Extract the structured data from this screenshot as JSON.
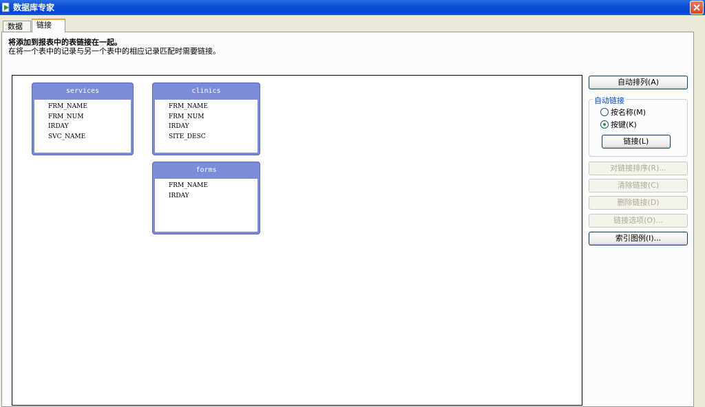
{
  "window": {
    "title": "数据库专家"
  },
  "tabs": [
    {
      "label": "数据"
    },
    {
      "label": "链接"
    }
  ],
  "header": {
    "title": "将添加到报表中的表链接在一起。",
    "subtitle": "在将一个表中的记录与另一个表中的相应记录匹配时需要链接。"
  },
  "tables": [
    {
      "name": "services",
      "fields": [
        "FRM_NAME",
        "FRM_NUM",
        "IRDAY",
        "SVC_NAME"
      ]
    },
    {
      "name": "clinics",
      "fields": [
        "FRM_NAME",
        "FRM_NUM",
        "IRDAY",
        "SITE_DESC"
      ]
    },
    {
      "name": "forms",
      "fields": [
        "FRM_NAME",
        "IRDAY"
      ]
    }
  ],
  "buttons": {
    "auto_arrange": "自动排列(A)",
    "link": "链接(L)",
    "order_links": "对链接排序(R)...",
    "clear_links": "清除链接(C)",
    "delete_link": "删除链接(D)",
    "link_options": "链接选项(O)...",
    "index_legend": "索引图例(I)..."
  },
  "auto_link": {
    "label": "自动链接",
    "options": [
      {
        "label": "按名称(M)",
        "selected": false
      },
      {
        "label": "按键(K)",
        "selected": true
      }
    ]
  }
}
